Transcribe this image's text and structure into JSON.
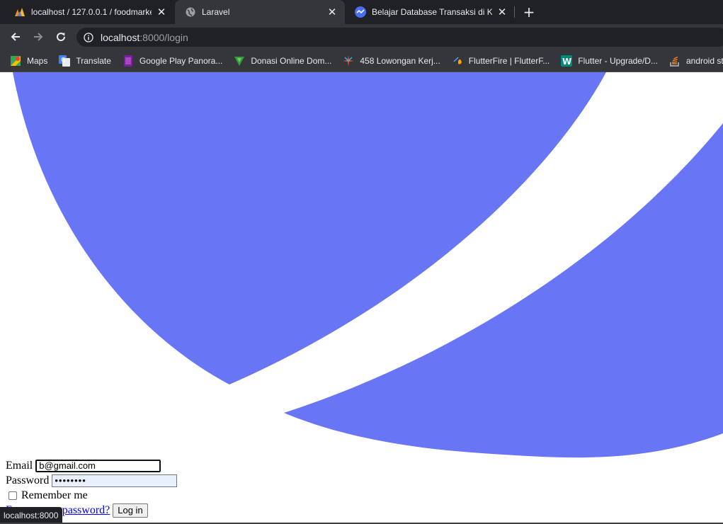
{
  "tabs": [
    {
      "title": "localhost / 127.0.0.1 / foodmarke",
      "icon": "phpmyadmin-icon"
    },
    {
      "title": "Laravel",
      "icon": "globe-icon"
    },
    {
      "title": "Belajar Database Transaksi di Kel",
      "icon": "site-icon"
    }
  ],
  "toolbar": {
    "url_host": "localhost",
    "url_path": ":8000/login"
  },
  "bookmarks": [
    {
      "label": "Maps",
      "icon": "maps-icon"
    },
    {
      "label": "Translate",
      "icon": "translate-icon"
    },
    {
      "label": "Google Play Panora...",
      "icon": "google-play-icon"
    },
    {
      "label": "Donasi Online Dom...",
      "icon": "donasi-icon"
    },
    {
      "label": "458 Lowongan Kerj...",
      "icon": "star-burst-icon"
    },
    {
      "label": "FlutterFire | FlutterF...",
      "icon": "flutterfire-icon"
    },
    {
      "label": "Flutter - Upgrade/D...",
      "icon": "w-icon"
    },
    {
      "label": "android stuc",
      "icon": "stackoverflow-icon"
    }
  ],
  "login": {
    "email_label": "Email",
    "email_value": "b@gmail.com",
    "password_label": "Password",
    "password_value": "••••••••",
    "remember_label": "Remember me",
    "forgot_label": "Forgot your password?",
    "login_button": "Log in"
  },
  "status": {
    "hover_url": "localhost:8000"
  },
  "colors": {
    "logo": "#6875f5",
    "tabbar": "#202124",
    "toolbar": "#35363a",
    "password_autofill": "#e8f0fe"
  }
}
